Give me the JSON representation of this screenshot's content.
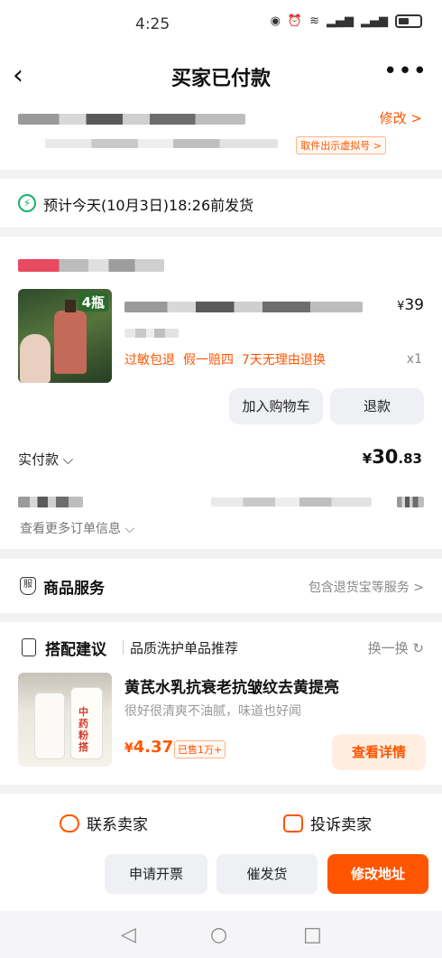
{
  "status_bar": {
    "time": "4:25"
  },
  "header": {
    "title": "买家已付款",
    "back_icon": "‹",
    "more_icon": "•••"
  },
  "address": {
    "edit_label": "修改 >",
    "pickup_label": "取件出示虚拟号 >"
  },
  "shipping": {
    "notice": "预计今天(10月3日)18:26前发货"
  },
  "order": {
    "product_badge": "4瓶",
    "price": "39",
    "currency": "¥",
    "tags": [
      "过敏包退",
      "假一赔四",
      "7天无理由退换"
    ],
    "quantity": "x1",
    "add_to_cart": "加入购物车",
    "refund": "退款",
    "paid_label": "实付款 ⌵",
    "paid_int": "30",
    "paid_dec": ".83",
    "more_info": "查看更多订单信息 ⌵"
  },
  "service": {
    "label": "商品服务",
    "detail": "包含退货宝等服务 >",
    "icon": "shield-icon"
  },
  "recommend": {
    "label": "搭配建议",
    "subtitle": "品质洗护单品推荐",
    "swap": "换一换 ↻",
    "bottle_text": "中药粉搭",
    "title": "黄芪水乳抗衰老抗皱纹去黄提亮",
    "desc": "很好很清爽不油腻，味道也好闻",
    "price": "4.37",
    "sold": "已售1万+",
    "detail_button": "查看详情"
  },
  "contact": {
    "seller": "联系卖家",
    "complain": "投诉卖家"
  },
  "actions": {
    "invoice": "申请开票",
    "urge": "催发货",
    "change_address": "修改地址"
  },
  "navbar": {
    "back": "◁",
    "home": "○",
    "recent": "□"
  },
  "colors": {
    "accent": "#ff5500",
    "success": "#1ab26b"
  }
}
